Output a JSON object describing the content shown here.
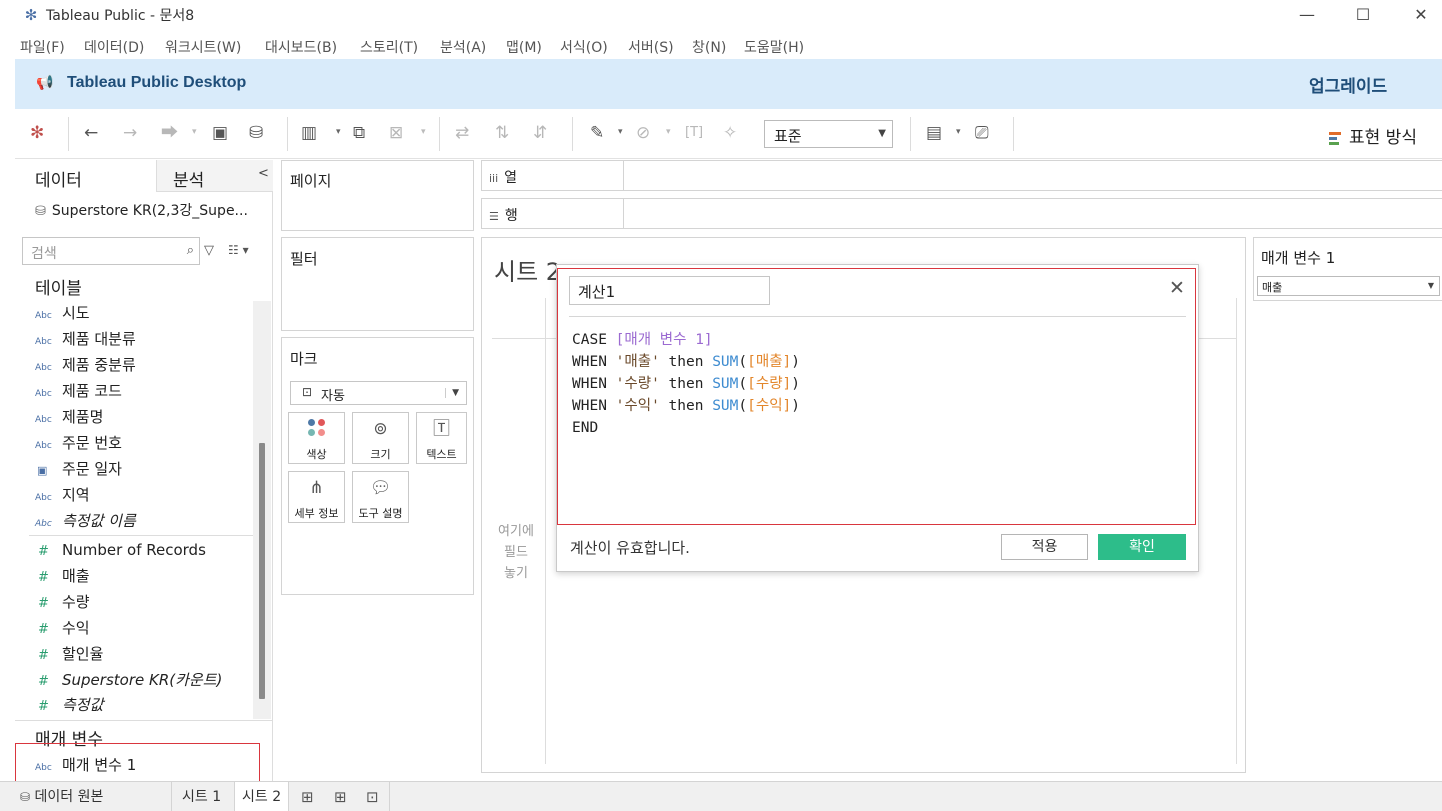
{
  "window": {
    "title": "Tableau Public - 문서8",
    "minimize": "—",
    "maximize": "☐",
    "close": "✕"
  },
  "menu": [
    "파일(F)",
    "데이터(D)",
    "워크시트(W)",
    "대시보드(B)",
    "스토리(T)",
    "분석(A)",
    "맵(M)",
    "서식(O)",
    "서버(S)",
    "창(N)",
    "도움말(H)"
  ],
  "banner": {
    "brand": "Tableau Public Desktop",
    "upgrade": "업그레이드"
  },
  "toolbar": {
    "fit_value": "표준",
    "show_me": "표현 방식"
  },
  "data_pane": {
    "tab_data": "데이터",
    "tab_analysis": "분석",
    "datasource": "Superstore KR(2,3강_Supe...",
    "search_placeholder": "검색",
    "tables_header": "테이블",
    "dimensions": [
      {
        "name": "시도",
        "type": "Abc"
      },
      {
        "name": "제품 대분류",
        "type": "Abc"
      },
      {
        "name": "제품 중분류",
        "type": "Abc"
      },
      {
        "name": "제품 코드",
        "type": "Abc"
      },
      {
        "name": "제품명",
        "type": "Abc"
      },
      {
        "name": "주문 번호",
        "type": "Abc"
      },
      {
        "name": "주문 일자",
        "type": "date"
      },
      {
        "name": "지역",
        "type": "Abc"
      },
      {
        "name": "측정값 이름",
        "type": "Abc"
      }
    ],
    "measures": [
      {
        "name": "Number of Records"
      },
      {
        "name": "매출"
      },
      {
        "name": "수량"
      },
      {
        "name": "수익"
      },
      {
        "name": "할인율"
      },
      {
        "name": "Superstore KR(카운트)"
      },
      {
        "name": "측정값"
      }
    ],
    "parameters_header": "매개 변수",
    "parameters": [
      {
        "name": "매개 변수 1",
        "type": "Abc"
      }
    ]
  },
  "cards": {
    "pages": "페이지",
    "filters": "필터",
    "marks": "마크",
    "mark_type": "자동",
    "mark_buttons": [
      "색상",
      "크기",
      "텍스트",
      "세부 정보",
      "도구 설명"
    ]
  },
  "shelves": {
    "columns": "열",
    "rows": "행"
  },
  "viz": {
    "sheet_title": "시트 2",
    "drop_hint": [
      "여기에",
      "필드",
      "놓기"
    ]
  },
  "parameter_control": {
    "title": "매개 변수 1",
    "value": "매출"
  },
  "calc_dialog": {
    "name": "계산1",
    "formula": {
      "line1": {
        "kw": "CASE",
        "param": "[매개 변수 1]"
      },
      "lines": [
        {
          "kw": "WHEN",
          "str": "'매출'",
          "then": "then",
          "fn": "SUM",
          "field": "[매출]"
        },
        {
          "kw": "WHEN",
          "str": "'수량'",
          "then": "then",
          "fn": "SUM",
          "field": "[수량]"
        },
        {
          "kw": "WHEN",
          "str": "'수익'",
          "then": "then",
          "fn": "SUM",
          "field": "[수익]"
        }
      ],
      "end": "END"
    },
    "status": "계산이 유효합니다.",
    "apply_label": "적용",
    "ok_label": "확인"
  },
  "bottom_tabs": {
    "datasource": "데이터 원본",
    "sheets": [
      "시트 1",
      "시트 2"
    ]
  },
  "colors": {
    "banner_bg": "#d9ebfa",
    "brand_text": "#1f4e79",
    "ok_button": "#2dbd8a",
    "highlight_border": "#d9363e",
    "formula_param": "#9b6ad1",
    "formula_function": "#3d8bd0",
    "formula_field": "#e3862b"
  }
}
